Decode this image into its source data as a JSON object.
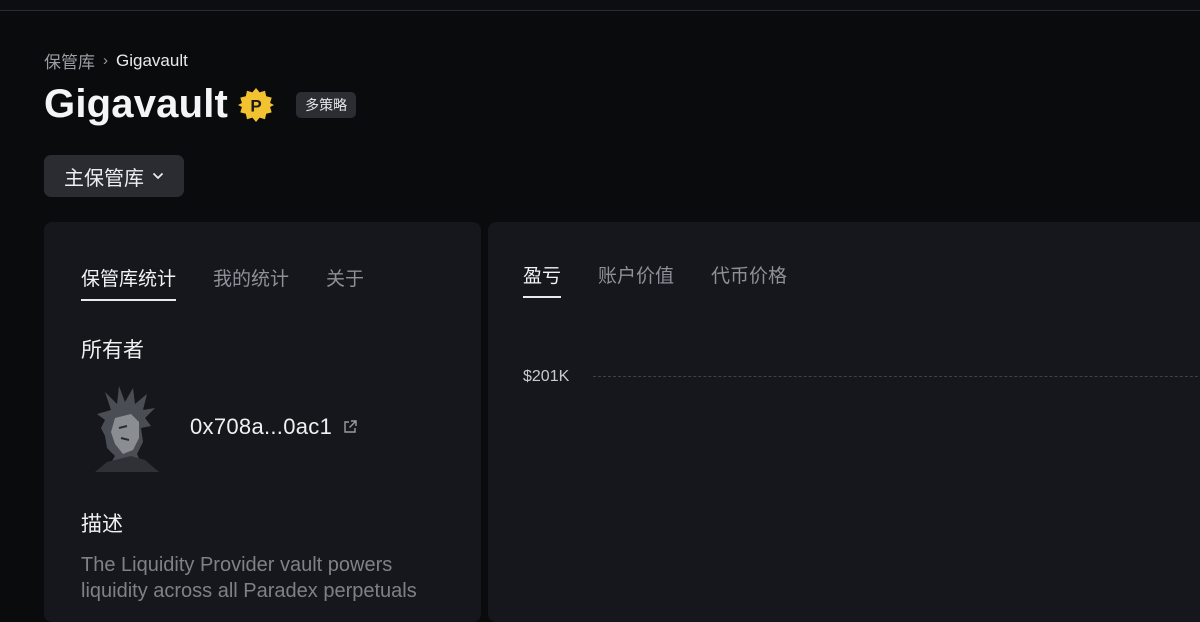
{
  "breadcrumb": {
    "root": "保管库",
    "separator": "›",
    "current": "Gigavault"
  },
  "header": {
    "title": "Gigavault",
    "badge_icon": "verified-p-badge-icon",
    "badge_letter": "P",
    "tag": "多策略"
  },
  "vault_selector": {
    "value": "主保管库"
  },
  "left_panel": {
    "tabs": [
      {
        "label": "保管库统计",
        "active": true
      },
      {
        "label": "我的统计",
        "active": false
      },
      {
        "label": "关于",
        "active": false
      }
    ],
    "owner_label": "所有者",
    "owner_address": "0x708a...0ac1",
    "description_label": "描述",
    "description_text": "The Liquidity Provider vault powers liquidity across all Paradex perpetuals"
  },
  "right_panel": {
    "tabs": [
      {
        "label": "盈亏",
        "active": true
      },
      {
        "label": "账户价值",
        "active": false
      },
      {
        "label": "代币价格",
        "active": false
      }
    ],
    "y_axis_label": "$201K"
  },
  "colors": {
    "background": "#0a0b0d",
    "card": "#15171c",
    "badge_gold": "#f2c230",
    "tag_bg": "#2b2d33"
  }
}
